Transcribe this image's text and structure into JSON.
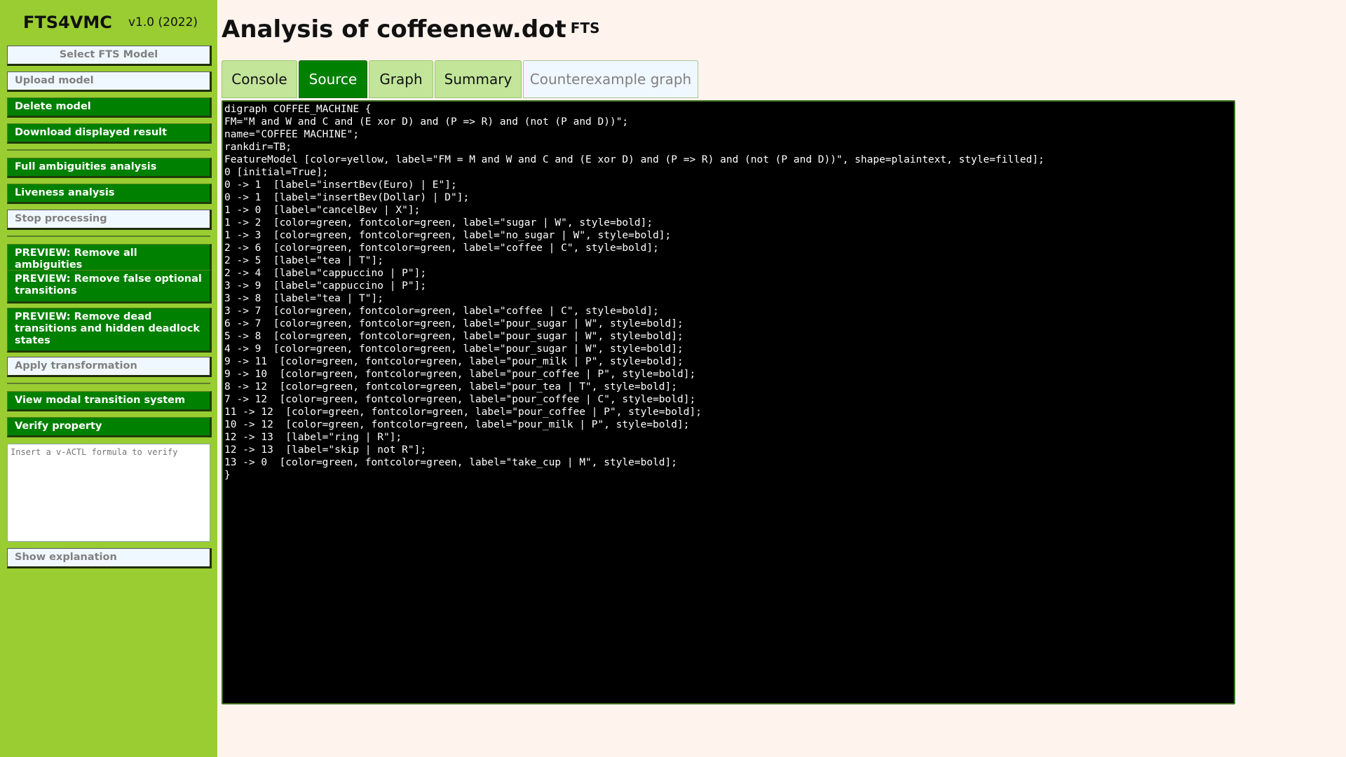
{
  "sidebar": {
    "brand": "FTS4VMC",
    "version": "v1.0 (2022)",
    "select_model": "Select FTS Model",
    "upload_model": "Upload model",
    "delete_model": "Delete model",
    "download_result": "Download displayed result",
    "full_ambiguities": "Full ambiguities analysis",
    "liveness": "Liveness analysis",
    "stop_processing": "Stop processing",
    "preview_remove_all": "PREVIEW: Remove all ambiguities",
    "preview_false_optional": "PREVIEW: Remove false optional transitions",
    "preview_dead": "PREVIEW: Remove dead transitions and hidden deadlock states",
    "apply_transformation": "Apply transformation",
    "view_mts": "View modal transition system",
    "verify_property": "Verify property",
    "formula_placeholder": "Insert a v-ACTL formula to verify",
    "show_explanation": "Show explanation"
  },
  "main": {
    "title": "Analysis of coffeenew.dot",
    "title_suffix": "FTS",
    "tabs": [
      {
        "label": "Console"
      },
      {
        "label": "Source"
      },
      {
        "label": "Graph"
      },
      {
        "label": "Summary"
      },
      {
        "label": "Counterexample graph"
      }
    ],
    "active_tab": "Source",
    "source_lines": [
      "digraph COFFEE_MACHINE {",
      "FM=\"M and W and C and (E xor D) and (P => R) and (not (P and D))\";",
      "name=\"COFFEE MACHINE\";",
      "rankdir=TB;",
      "FeatureModel [color=yellow, label=\"FM = M and W and C and (E xor D) and (P => R) and (not (P and D))\", shape=plaintext, style=filled];",
      "0 [initial=True];",
      "0 -> 1  [label=\"insertBev(Euro) | E\"];",
      "0 -> 1  [label=\"insertBev(Dollar) | D\"];",
      "1 -> 0  [label=\"cancelBev | X\"];",
      "1 -> 2  [color=green, fontcolor=green, label=\"sugar | W\", style=bold];",
      "1 -> 3  [color=green, fontcolor=green, label=\"no_sugar | W\", style=bold];",
      "2 -> 6  [color=green, fontcolor=green, label=\"coffee | C\", style=bold];",
      "2 -> 5  [label=\"tea | T\"];",
      "2 -> 4  [label=\"cappuccino | P\"];",
      "3 -> 9  [label=\"cappuccino | P\"];",
      "3 -> 8  [label=\"tea | T\"];",
      "3 -> 7  [color=green, fontcolor=green, label=\"coffee | C\", style=bold];",
      "6 -> 7  [color=green, fontcolor=green, label=\"pour_sugar | W\", style=bold];",
      "5 -> 8  [color=green, fontcolor=green, label=\"pour_sugar | W\", style=bold];",
      "4 -> 9  [color=green, fontcolor=green, label=\"pour_sugar | W\", style=bold];",
      "9 -> 11  [color=green, fontcolor=green, label=\"pour_milk | P\", style=bold];",
      "9 -> 10  [color=green, fontcolor=green, label=\"pour_coffee | P\", style=bold];",
      "8 -> 12  [color=green, fontcolor=green, label=\"pour_tea | T\", style=bold];",
      "7 -> 12  [color=green, fontcolor=green, label=\"pour_coffee | C\", style=bold];",
      "11 -> 12  [color=green, fontcolor=green, label=\"pour_coffee | P\", style=bold];",
      "10 -> 12  [color=green, fontcolor=green, label=\"pour_milk | P\", style=bold];",
      "12 -> 13  [label=\"ring | R\"];",
      "12 -> 13  [label=\"skip | not R\"];",
      "13 -> 0  [color=green, fontcolor=green, label=\"take_cup | M\", style=bold];",
      "}"
    ]
  },
  "colors": {
    "sidebar_bg": "#9acd32",
    "button_green": "#008000",
    "button_disabled": "#f0f8ff",
    "tab_inactive": "#c2e59a",
    "page_bg": "#fff3ee",
    "console_bg": "#000000"
  }
}
